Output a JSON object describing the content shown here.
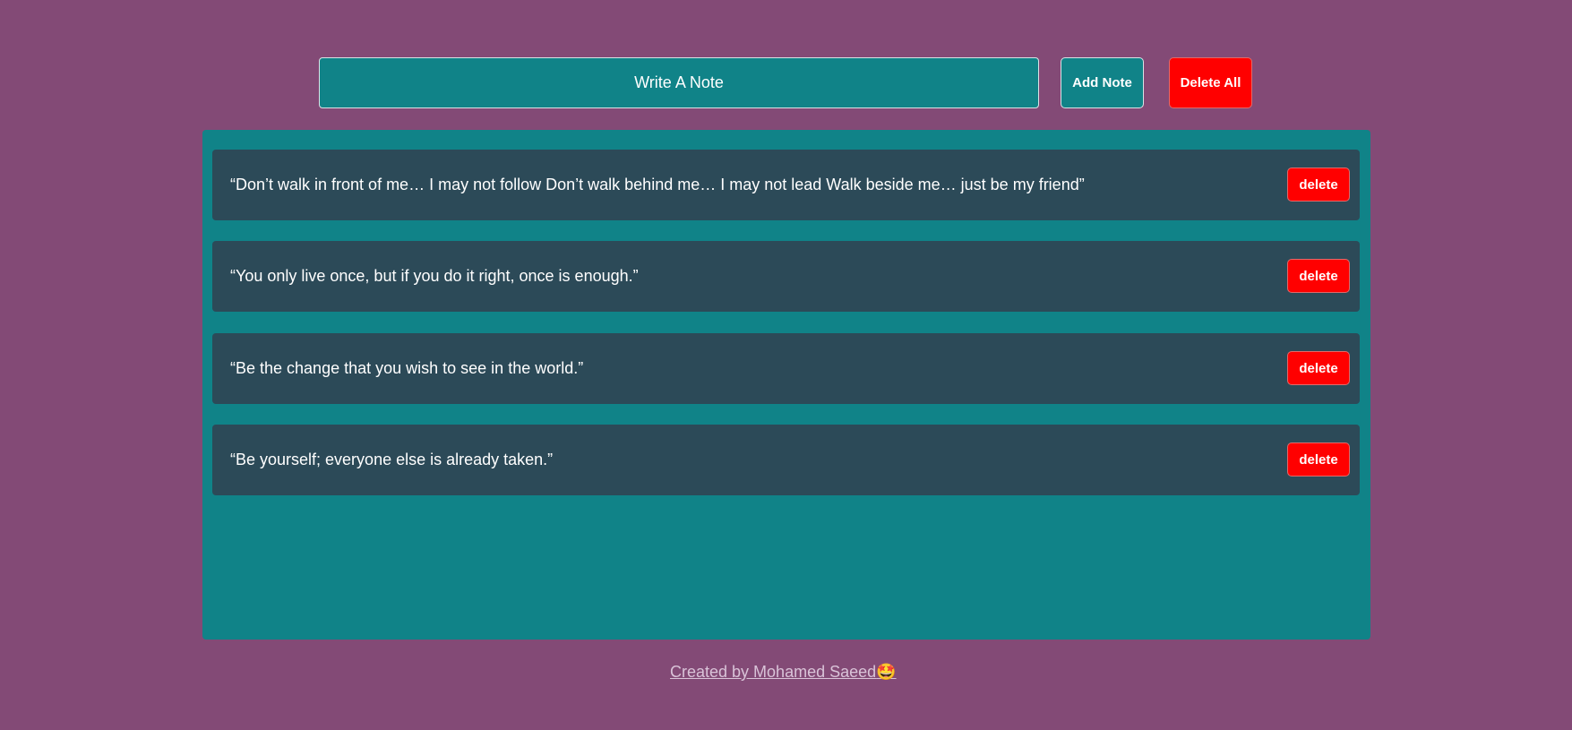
{
  "colors": {
    "page_background": "#834A76",
    "teal": "#108388",
    "note_background": "#2C4A58",
    "danger": "#FF0000",
    "text": "#FFFFFF",
    "footer_text": "#D9C3D8"
  },
  "toolbar": {
    "note_input_placeholder": "Write A Note",
    "note_input_value": "",
    "add_button_label": "Add Note",
    "delete_all_label": "Delete All"
  },
  "notes": [
    {
      "text": "“Don’t walk in front of me… I may not follow Don’t walk behind me… I may not lead Walk beside me… just be my friend”",
      "delete_label": "delete"
    },
    {
      "text": "“You only live once, but if you do it right, once is enough.”",
      "delete_label": "delete"
    },
    {
      "text": "“Be the change that you wish to see in the world.”",
      "delete_label": "delete"
    },
    {
      "text": "“Be yourself; everyone else is already taken.”",
      "delete_label": "delete"
    }
  ],
  "footer": {
    "credit_text": "Created by Mohamed Saeed",
    "credit_emoji": "🤩",
    "credit_emoji_icon": "star-struck-emoji-icon"
  }
}
